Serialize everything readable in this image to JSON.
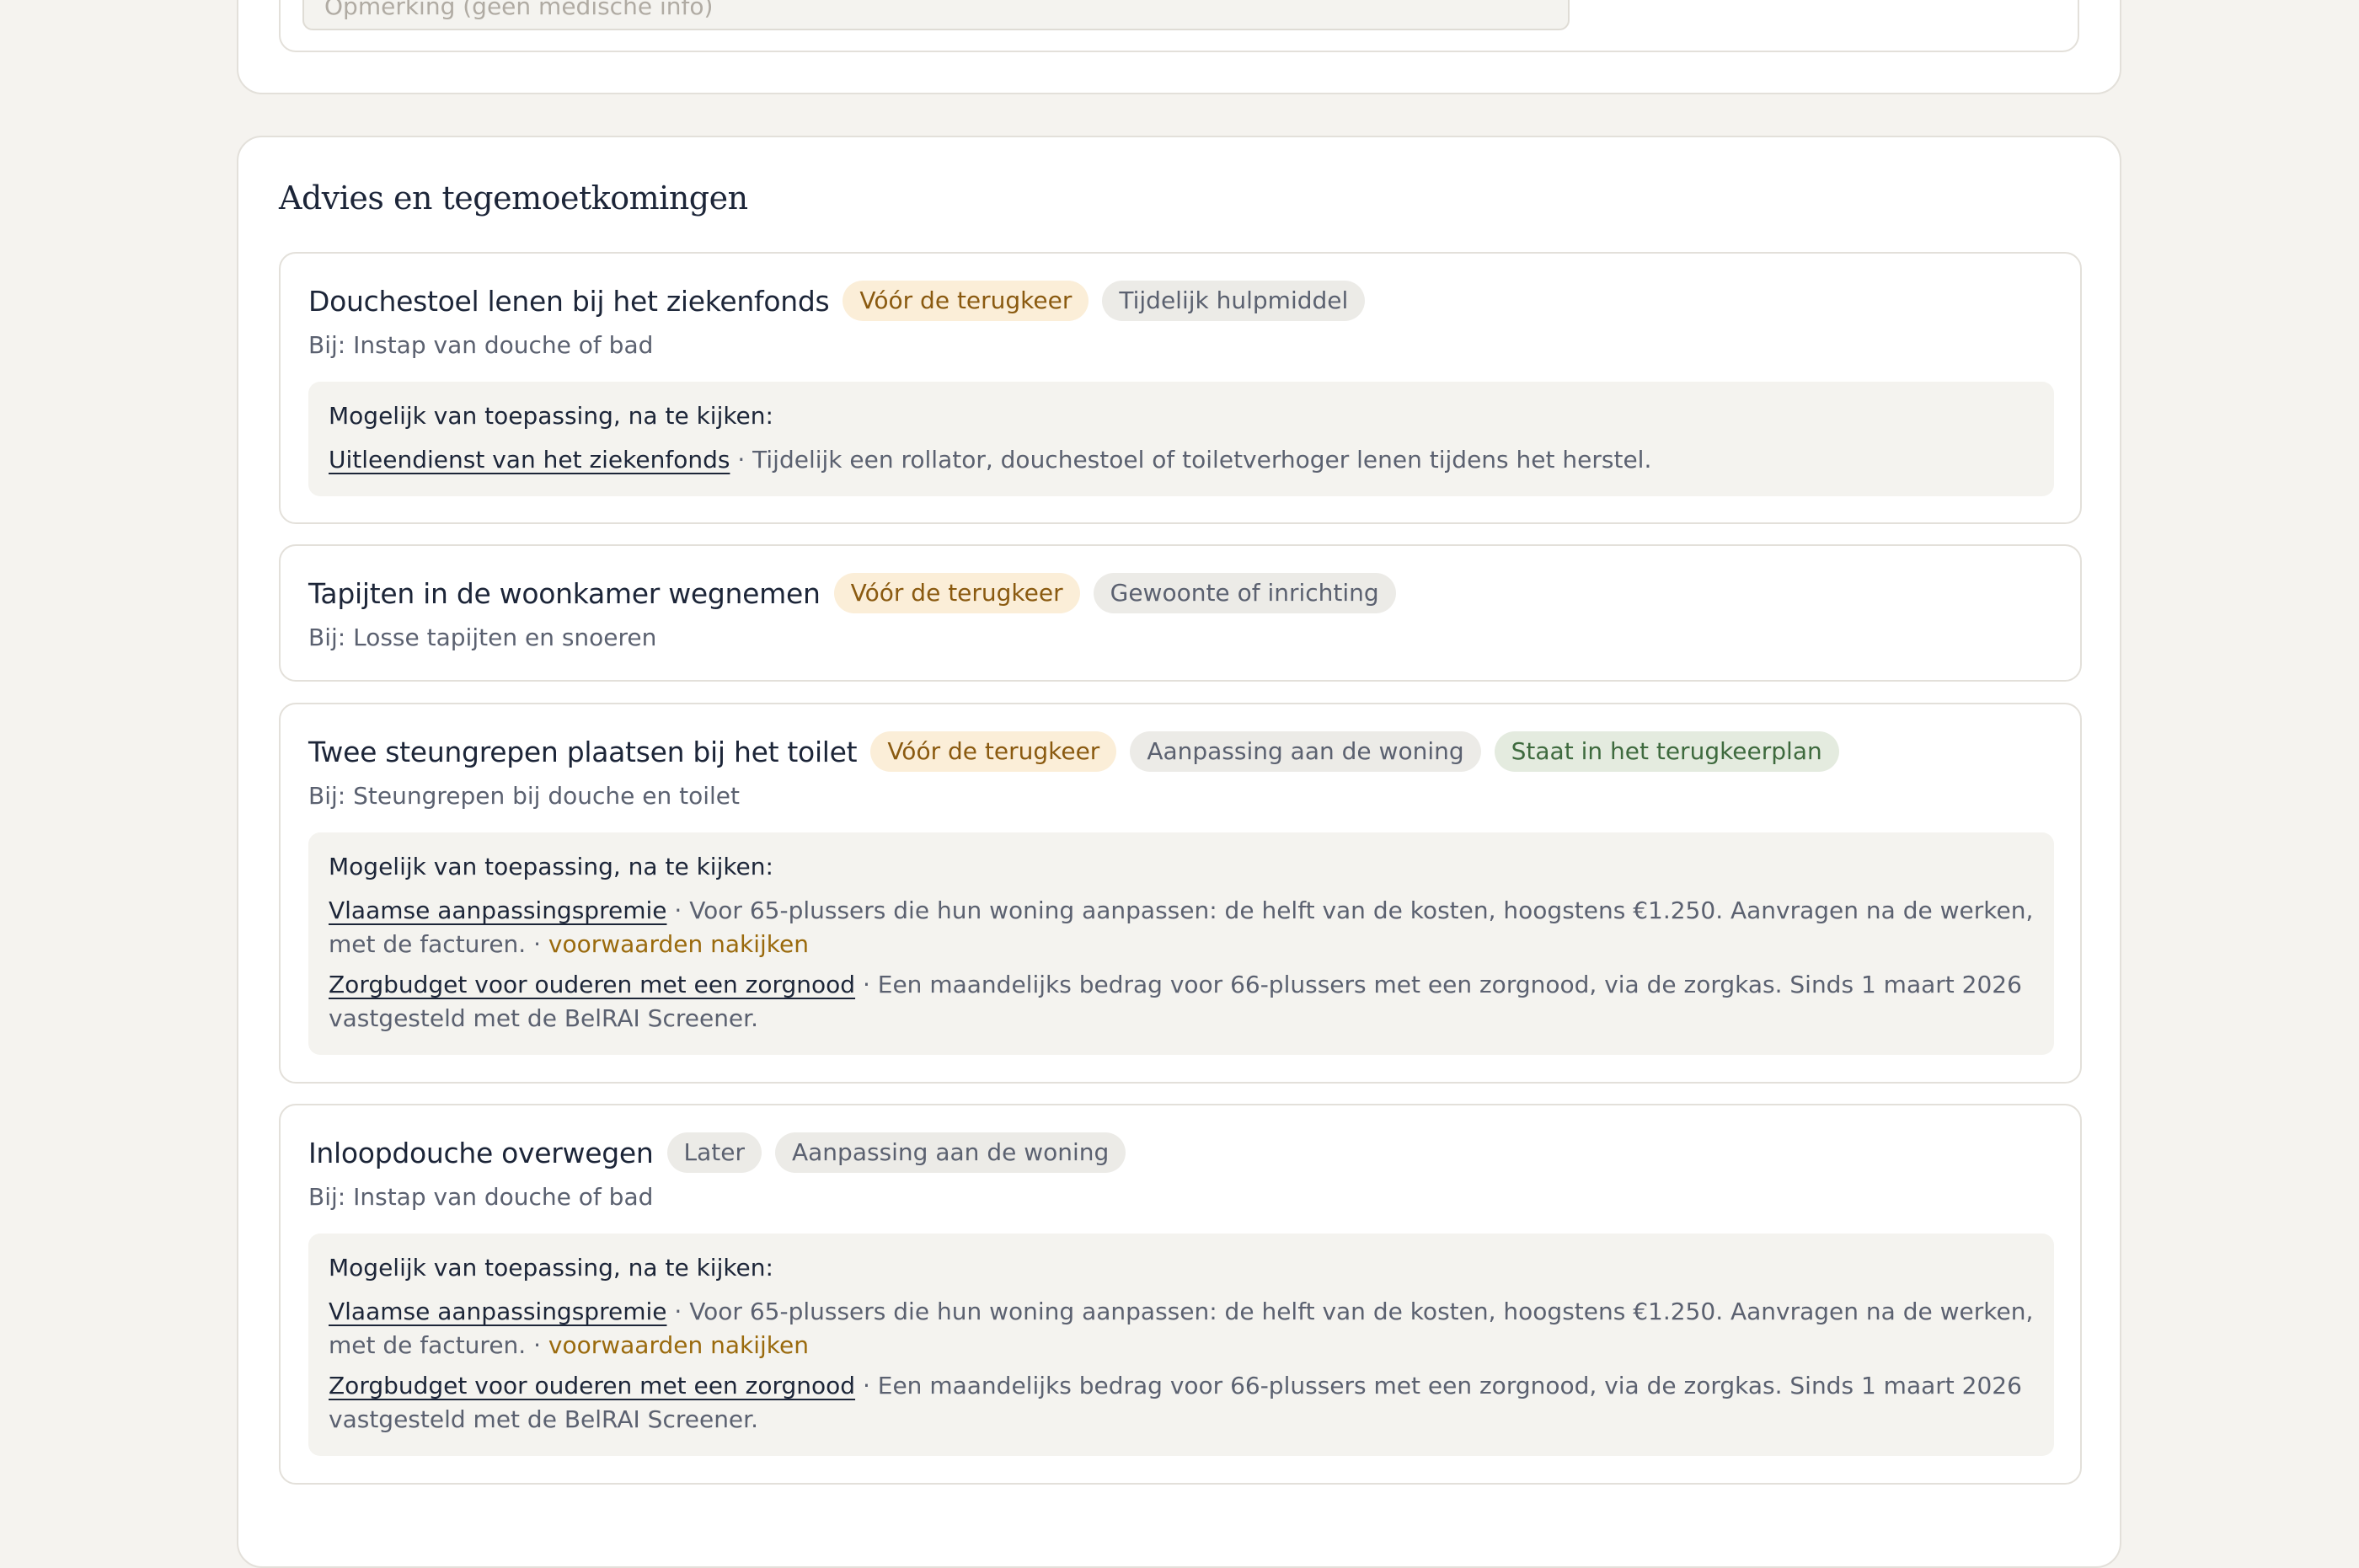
{
  "note_field": {
    "placeholder": "Opmerking (geen medische info)"
  },
  "advice_section": {
    "title": "Advies en tegemoetkomingen",
    "applicable_label": "Mogelijk van toepassing, na te kijken:",
    "separator": " · ",
    "conditions_link": "voorwaarden nakijken",
    "cards": [
      {
        "title": "Douchestoel lenen bij het ziekenfonds",
        "tags": [
          "Vóór de terugkeer",
          "Tijdelijk hulpmiddel"
        ],
        "sub": "Bij: Instap van douche of bad",
        "items": [
          {
            "link": "Uitleendienst van het ziekenfonds",
            "text": "Tijdelijk een rollator, douchestoel of toiletverhoger lenen tijdens het herstel."
          }
        ]
      },
      {
        "title": "Tapijten in de woonkamer wegnemen",
        "tags": [
          "Vóór de terugkeer",
          "Gewoonte of inrichting"
        ],
        "sub": "Bij: Losse tapijten en snoeren"
      },
      {
        "title": "Twee steungrepen plaatsen bij het toilet",
        "tags": [
          "Vóór de terugkeer",
          "Aanpassing aan de woning",
          "Staat in het terugkeerplan"
        ],
        "sub": "Bij: Steungrepen bij douche en toilet",
        "items": [
          {
            "link": "Vlaamse aanpassingspremie",
            "text": "Voor 65-plussers die hun woning aanpassen: de helft van de kosten, hoogstens €1.250. Aanvragen na de werken, met de facturen."
          },
          {
            "link": "Zorgbudget voor ouderen met een zorgnood",
            "text": "Een maandelijks bedrag voor 66-plussers met een zorgnood, via de zorgkas. Sinds 1 maart 2026 vastgesteld met de BelRAI Screener."
          }
        ]
      },
      {
        "title": "Inloopdouche overwegen",
        "tags": [
          "Later",
          "Aanpassing aan de woning"
        ],
        "sub": "Bij: Instap van douche of bad",
        "items": [
          {
            "link": "Vlaamse aanpassingspremie",
            "text": "Voor 65-plussers die hun woning aanpassen: de helft van de kosten, hoogstens €1.250. Aanvragen na de werken, met de facturen."
          },
          {
            "link": "Zorgbudget voor ouderen met een zorgnood",
            "text": "Een maandelijks bedrag voor 66-plussers met een zorgnood, via de zorgkas. Sinds 1 maart 2026 vastgesteld met de BelRAI Screener."
          }
        ]
      }
    ]
  }
}
